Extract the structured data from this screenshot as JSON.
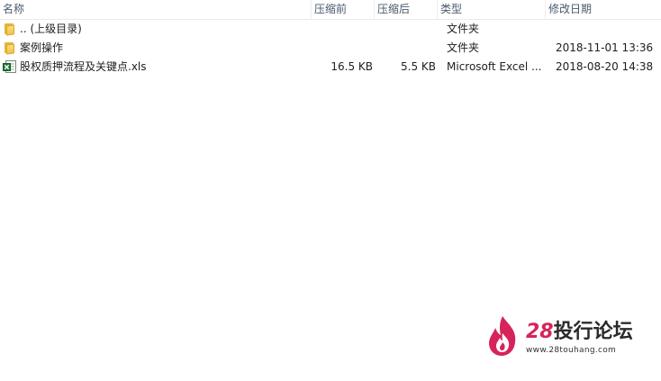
{
  "columns": {
    "name": "名称",
    "compressed": "压缩前",
    "original": "压缩后",
    "type": "类型",
    "modified": "修改日期"
  },
  "files": [
    {
      "icon": "folder-icon",
      "name": ".. (上级目录)",
      "compressed": "",
      "original": "",
      "type": "文件夹",
      "modified": ""
    },
    {
      "icon": "folder-icon",
      "name": "案例操作",
      "compressed": "",
      "original": "",
      "type": "文件夹",
      "modified": "2018-11-01 13:36"
    },
    {
      "icon": "excel-file-icon",
      "name": "股权质押流程及关键点.xls",
      "compressed": "16.5 KB",
      "original": "5.5 KB",
      "type": "Microsoft Excel ...",
      "modified": "2018-08-20 14:38"
    }
  ],
  "watermark": {
    "brand_number": "28",
    "brand_text": "投行论坛",
    "url": "www.28touhang.com",
    "accent_color": "#d6245a"
  }
}
